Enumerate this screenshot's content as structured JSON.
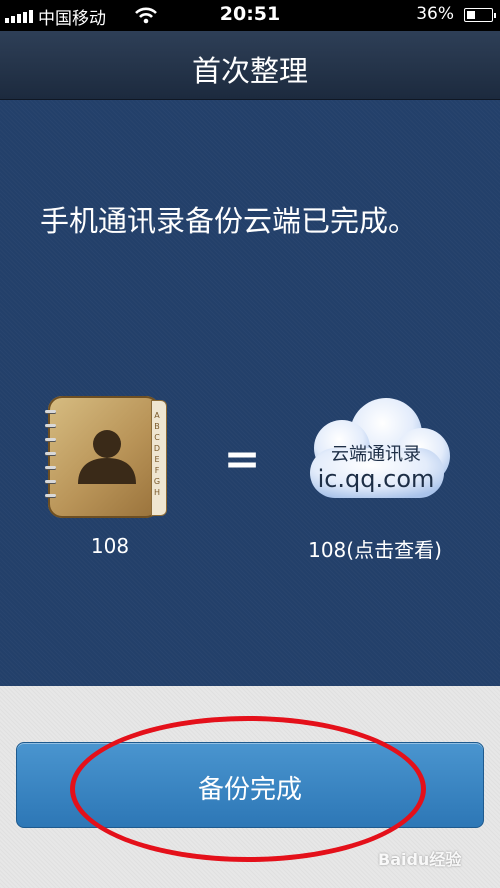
{
  "status_bar": {
    "carrier": "中国移动",
    "time": "20:51",
    "battery_percent": "36%",
    "battery_level": 0.36,
    "signal_bars": 5
  },
  "nav": {
    "title": "首次整理"
  },
  "main": {
    "message": "手机通讯录备份云端已完成。",
    "phone_contacts_count": "108",
    "equals_sign": "=",
    "cloud": {
      "title": "云端通讯录",
      "url": "ic.qq.com",
      "count_label": "108(点击查看)"
    }
  },
  "bottom": {
    "done_button_label": "备份完成"
  },
  "watermark": "Baidu经验",
  "colors": {
    "main_bg": "#23406a",
    "button_blue": "#3a86c4",
    "annotation_red": "#e4101a"
  }
}
